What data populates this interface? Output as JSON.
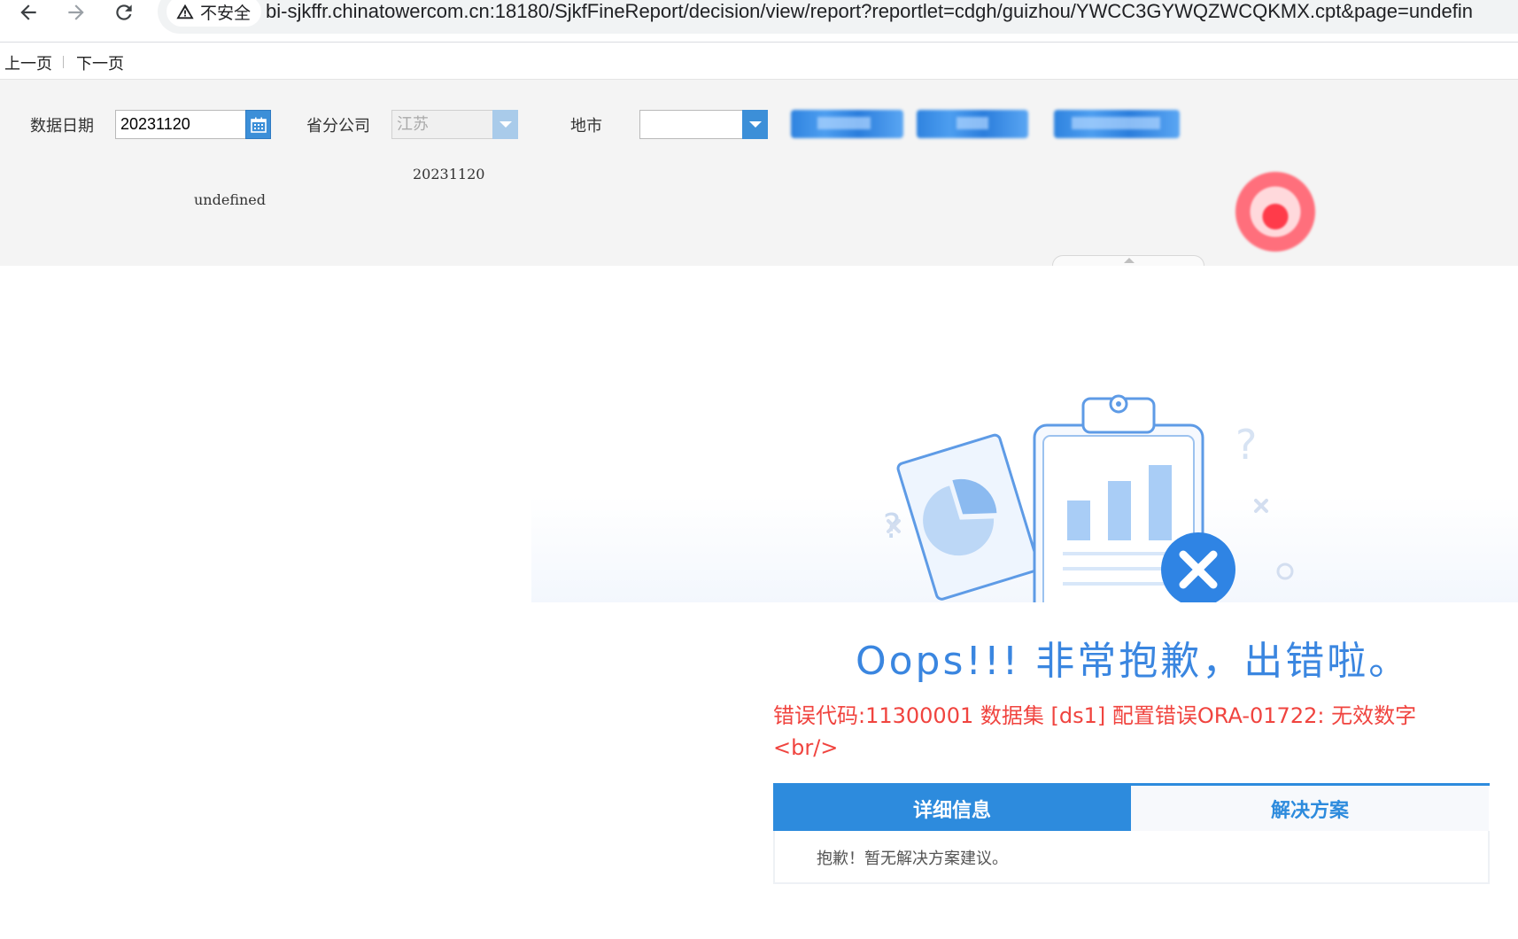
{
  "browser": {
    "back_icon": "arrow-left-icon",
    "forward_icon": "arrow-right-icon",
    "reload_icon": "reload-icon",
    "security_icon": "warning-triangle-icon",
    "security_label": "不安全",
    "url": "bi-sjkffr.chinatowercom.cn:18180/SjkfFineReport/decision/view/report?reportlet=cdgh/guizhou/YWCC3GYWQZWCQKMX.cpt&page=undefin"
  },
  "pager": {
    "prev_label": "上一页",
    "next_label": "下一页"
  },
  "params": {
    "date_label": "数据日期",
    "date_value": "20231120",
    "province_label": "省分公司",
    "province_value": "江苏",
    "city_label": "地市",
    "city_value": "",
    "echo_date": "20231120",
    "echo_undefined": "undefined"
  },
  "error": {
    "title": "Oops!!! 非常抱歉，出错啦。",
    "message": "错误代码:11300001 数据集 [ds1] 配置错误ORA-01722: 无效数字 <br/>",
    "tabs": [
      {
        "label": "详细信息"
      },
      {
        "label": "解决方案"
      }
    ],
    "content": "抱歉！暂无解决方案建议。"
  },
  "colors": {
    "accent": "#2d8bdd",
    "title_blue": "#3a86e0",
    "error_red": "#f0443f"
  }
}
